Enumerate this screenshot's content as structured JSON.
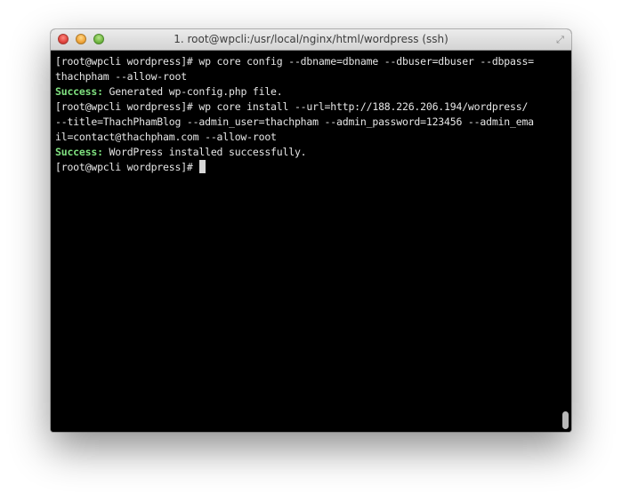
{
  "window": {
    "title": "1. root@wpcli:/usr/local/nginx/html/wordpress (ssh)"
  },
  "icons": {
    "close": "close-icon",
    "minimize": "minimize-icon",
    "zoom": "zoom-icon",
    "fullscreen": "fullscreen-icon"
  },
  "colors": {
    "background": "#000000",
    "text": "#e6e6e6",
    "success": "#7fe07f"
  },
  "terminal": {
    "lines": [
      {
        "prefix": "",
        "text": "[root@wpcli wordpress]# wp core config --dbname=dbname --dbuser=dbuser --dbpass="
      },
      {
        "prefix": "",
        "text": "thachpham --allow-root"
      },
      {
        "prefix": "Success:",
        "text": " Generated wp-config.php file."
      },
      {
        "prefix": "",
        "text": "[root@wpcli wordpress]# wp core install --url=http://188.226.206.194/wordpress/"
      },
      {
        "prefix": "",
        "text": "--title=ThachPhamBlog --admin_user=thachpham --admin_password=123456 --admin_ema"
      },
      {
        "prefix": "",
        "text": "il=contact@thachpham.com --allow-root"
      },
      {
        "prefix": "Success:",
        "text": " WordPress installed successfully."
      }
    ],
    "prompt": "[root@wpcli wordpress]# "
  }
}
